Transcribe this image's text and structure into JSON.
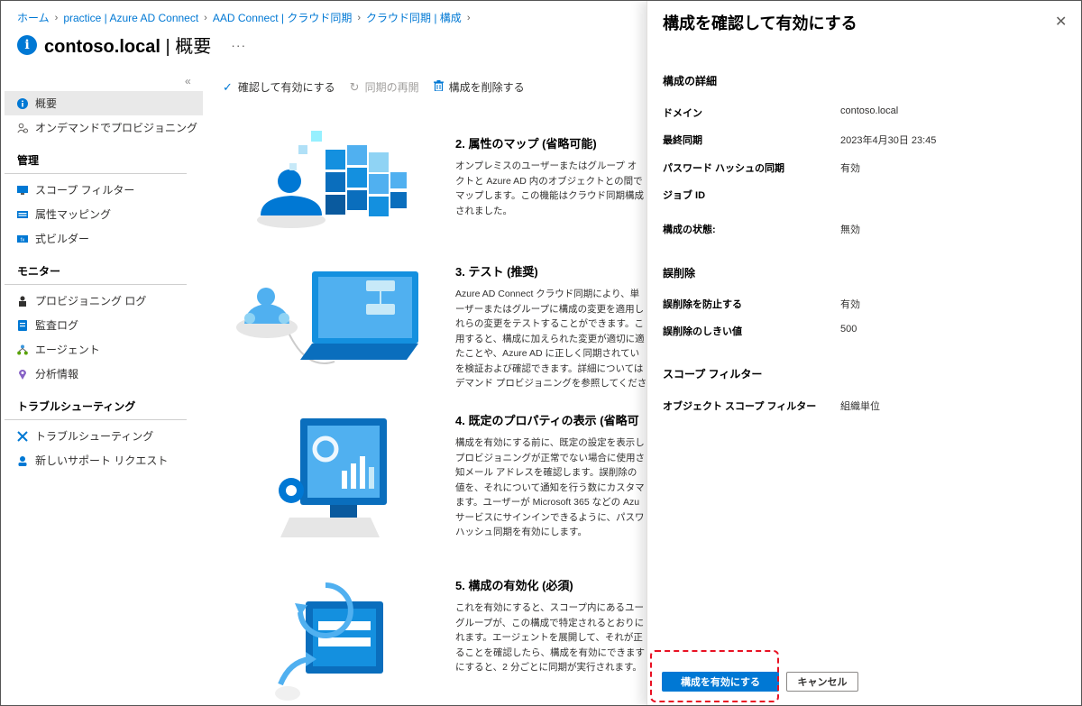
{
  "breadcrumb": [
    {
      "label": "ホーム"
    },
    {
      "label": "practice | Azure AD Connect"
    },
    {
      "label": "AAD Connect | クラウド同期"
    },
    {
      "label": "クラウド同期 | 構成"
    }
  ],
  "header": {
    "title_main": "contoso.local",
    "title_sep": " | ",
    "title_sub": "概要",
    "more": "···"
  },
  "sidebar": {
    "collapse": "«",
    "top_items": [
      {
        "label": "概要",
        "icon": "info-icon"
      },
      {
        "label": "オンデマンドでプロビジョニング",
        "icon": "provision-user-icon"
      }
    ],
    "groups": [
      {
        "title": "管理",
        "items": [
          {
            "label": "スコープ フィルター",
            "icon": "scope-filter-icon"
          },
          {
            "label": "属性マッピング",
            "icon": "attribute-mapping-icon"
          },
          {
            "label": "式ビルダー",
            "icon": "expression-builder-icon"
          }
        ]
      },
      {
        "title": "モニター",
        "items": [
          {
            "label": "プロビジョニング ログ",
            "icon": "provisioning-log-icon"
          },
          {
            "label": "監査ログ",
            "icon": "audit-log-icon"
          },
          {
            "label": "エージェント",
            "icon": "agent-icon"
          },
          {
            "label": "分析情報",
            "icon": "insights-icon"
          }
        ]
      },
      {
        "title": "トラブルシューティング",
        "items": [
          {
            "label": "トラブルシューティング",
            "icon": "troubleshoot-icon"
          },
          {
            "label": "新しいサポート リクエスト",
            "icon": "support-request-icon"
          }
        ]
      }
    ]
  },
  "toolbar": {
    "review_enable": "確認して有効にする",
    "restart_sync": "同期の再開",
    "delete_config": "構成を削除する"
  },
  "steps": [
    {
      "title": "2. 属性のマップ (省略可能)",
      "lines": [
        "オンプレミスのユーザーまたはグループ オ",
        "クトと Azure AD 内のオブジェクトとの間で",
        "マップします。この機能はクラウド同期構成",
        "されました。"
      ]
    },
    {
      "title": "3. テスト (推奨)",
      "lines": [
        "Azure AD Connect クラウド同期により、単",
        "ーザーまたはグループに構成の変更を適用し",
        "れらの変更をテストすることができます。こ",
        "用すると、構成に加えられた変更が適切に適",
        "たことや、Azure AD に正しく同期されてい",
        "を検証および確認できます。詳細については",
        "デマンド プロビジョニングを参照してくださ"
      ]
    },
    {
      "title": "4. 既定のプロパティの表示 (省略可",
      "lines": [
        "構成を有効にする前に、既定の設定を表示し",
        "プロビジョニングが正常でない場合に使用さ",
        "知メール アドレスを確認します。誤削除の",
        "値を、それについて通知を行う数にカスタマ",
        "ます。ユーザーが Microsoft 365 などの Azu",
        "サービスにサインインできるように、パスワ",
        "ハッシュ同期を有効にします。"
      ]
    },
    {
      "title": "5. 構成の有効化 (必須)",
      "lines": [
        "これを有効にすると、スコープ内にあるユー",
        "グループが、この構成で特定されるとおりに",
        "れます。エージェントを展開して、それが正",
        "ることを確認したら、構成を有効にできます",
        "にすると、2 分ごとに同期が実行されます。"
      ]
    }
  ],
  "panel": {
    "title": "構成を確認して有効にする",
    "close": "✕",
    "sec_details": "構成の詳細",
    "domain_label": "ドメイン",
    "domain_value": "contoso.local",
    "last_sync_label": "最終同期",
    "last_sync_value": "2023年4月30日 23:45",
    "phs_label": "パスワード ハッシュの同期",
    "phs_value": "有効",
    "job_id_label": "ジョブ ID",
    "state_label": "構成の状態:",
    "state_value": "無効",
    "sec_accidental": "誤削除",
    "prevent_label": "誤削除を防止する",
    "prevent_value": "有効",
    "threshold_label": "誤削除のしきい値",
    "threshold_value": "500",
    "sec_scope": "スコープ フィルター",
    "object_scope_label": "オブジェクト スコープ フィルター",
    "object_scope_value": "組織単位",
    "enable_button": "構成を有効にする",
    "cancel_button": "キャンセル"
  },
  "colors": {
    "accent": "#0078d4",
    "highlight": "#e81123"
  }
}
